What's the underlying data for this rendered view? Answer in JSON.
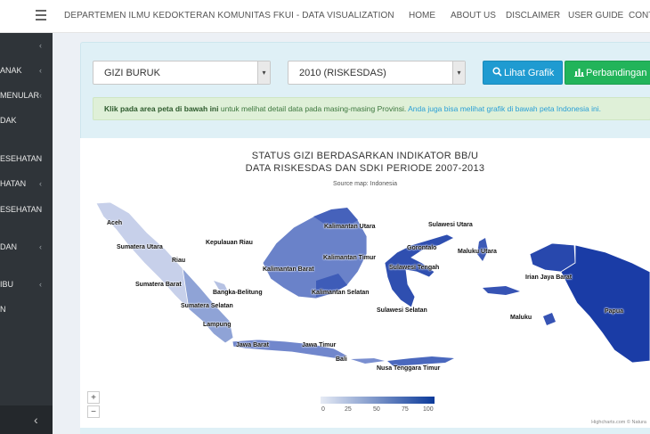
{
  "header": {
    "brand": "DEPARTEMEN ILMU KEDOKTERAN KOMUNITAS FKUI - DATA VISUALIZATION",
    "nav": [
      "HOME",
      "ABOUT US",
      "DISCLAIMER",
      "USER GUIDE",
      "CONT"
    ]
  },
  "sidebar": {
    "items": [
      "",
      "ANAK",
      "MENULAR",
      "DAK",
      "ESEHATAN",
      "HATAN",
      "ESEHATAN",
      "DAN",
      "IBU",
      "N"
    ]
  },
  "filters": {
    "indicator": "GIZI BURUK",
    "period": "2010 (RISKESDAS)",
    "btn_grafik": "Lihat Grafik",
    "btn_perbandingan": "Perbandingan"
  },
  "alert": {
    "bold": "Klik pada area peta di bawah ini",
    "text": " untuk melihat detail data pada masing-masing Provinsi. ",
    "link": "Anda juga bisa melihat grafik di bawah peta Indonesia ini."
  },
  "map": {
    "title_line1": "STATUS GIZI BERDASARKAN INDIKATOR BB/U",
    "title_line2": "DATA RISKESDAS DAN SDKI PERIODE 2007-2013",
    "subtitle": "Source map: Indonesia",
    "zoom_in": "+",
    "zoom_out": "−",
    "legend_ticks": [
      "0",
      "25",
      "50",
      "75",
      "100"
    ],
    "credit": "Highcharts.com © Natura",
    "color_low": "#e6ebf5",
    "color_high": "#0b3a9a",
    "regions": [
      "Aceh",
      "Sumatera Utara",
      "Kepulauan Riau",
      "Riau",
      "Sumatera Barat",
      "Bangka-Belitung",
      "Sumatera Selatan",
      "Lampung",
      "Jawa Barat",
      "Jawa Timur",
      "Bali",
      "Nusa Tenggara Timur",
      "Kalimantan Utara",
      "Kalimantan Barat",
      "Kalimantan Timur",
      "Kalimantan Selatan",
      "Sulawesi Utara",
      "Gorontalo",
      "Maluku Utara",
      "Sulawesi Tengah",
      "Sulawesi Selatan",
      "Irian Jaya Barat",
      "Maluku",
      "Papua"
    ]
  }
}
